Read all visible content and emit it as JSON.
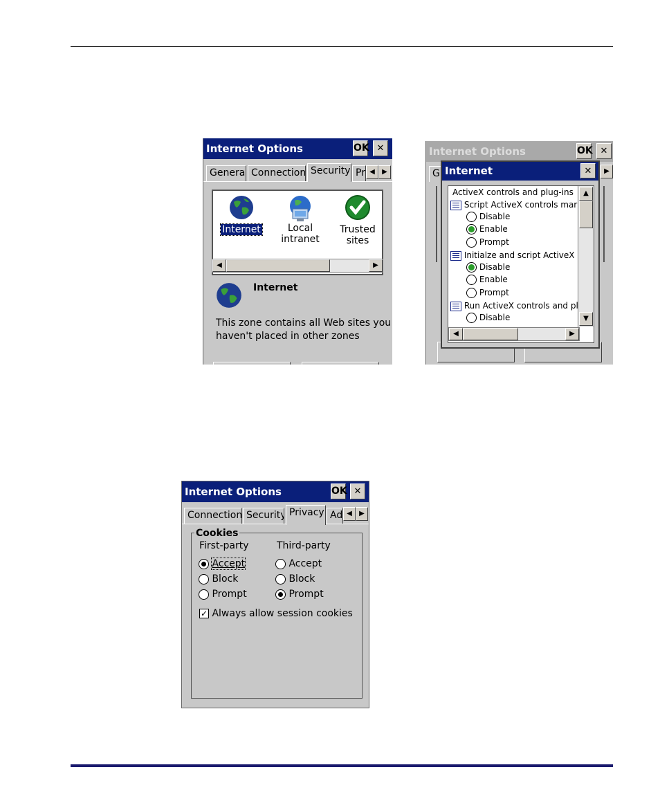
{
  "shot1": {
    "title": "Internet Options",
    "ok": "OK",
    "close": "✕",
    "tabs": [
      "General",
      "Connection",
      "Security",
      "Pr"
    ],
    "zones": [
      {
        "label1": "Internet",
        "label2": ""
      },
      {
        "label1": "Local",
        "label2": "intranet"
      },
      {
        "label1": "Trusted",
        "label2": "sites"
      }
    ],
    "zone_name": "Internet",
    "zone_desc_1": "This zone contains all Web sites you",
    "zone_desc_2": "haven't placed in other zones"
  },
  "shot2": {
    "bg_title": "Internet Options",
    "bg_ok": "OK",
    "bg_close": "✕",
    "bg_tab": "G",
    "dialog_title": "Internet",
    "dialog_close": "✕",
    "list": {
      "header": "ActiveX controls and plug-ins",
      "group1": "Script ActiveX controls marked",
      "group1_options": [
        "Disable",
        "Enable",
        "Prompt"
      ],
      "group2": "Initialze and script ActiveX co",
      "group2_options": [
        "Disable",
        "Enable",
        "Prompt"
      ],
      "group3": "Run ActiveX controls and plug",
      "group3_options": [
        "Disable"
      ]
    }
  },
  "shot3": {
    "title": "Internet Options",
    "ok": "OK",
    "close": "✕",
    "tabs": [
      "Connection",
      "Security",
      "Privacy",
      "Ad"
    ],
    "group_label": "Cookies",
    "first_party": "First-party",
    "third_party": "Third-party",
    "accept": "Accept",
    "block": "Block",
    "prompt": "Prompt",
    "first_selected": "Accept",
    "third_selected": "Prompt",
    "session_cookies": "Always allow session cookies",
    "session_checked": true
  }
}
